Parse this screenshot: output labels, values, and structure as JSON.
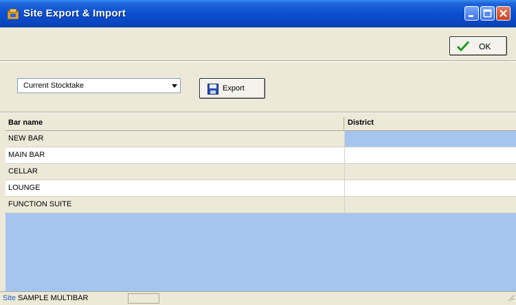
{
  "window": {
    "title": "Site Export & Import"
  },
  "toolbar": {
    "ok_label": "OK"
  },
  "export_panel": {
    "selected_option": "Current Stocktake",
    "export_label": "Export"
  },
  "grid": {
    "columns": [
      "Bar name",
      "District"
    ],
    "rows": [
      {
        "name": "NEW BAR",
        "district": ""
      },
      {
        "name": "MAIN BAR",
        "district": ""
      },
      {
        "name": "CELLAR",
        "district": ""
      },
      {
        "name": "LOUNGE",
        "district": ""
      },
      {
        "name": "FUNCTION SUITE",
        "district": ""
      }
    ]
  },
  "status": {
    "label": "Site",
    "value": "SAMPLE MULTIBAR"
  },
  "colors": {
    "titlebar": "#0a4fd0",
    "grid_background": "#a6c5ee",
    "window_background": "#ece9d8"
  }
}
